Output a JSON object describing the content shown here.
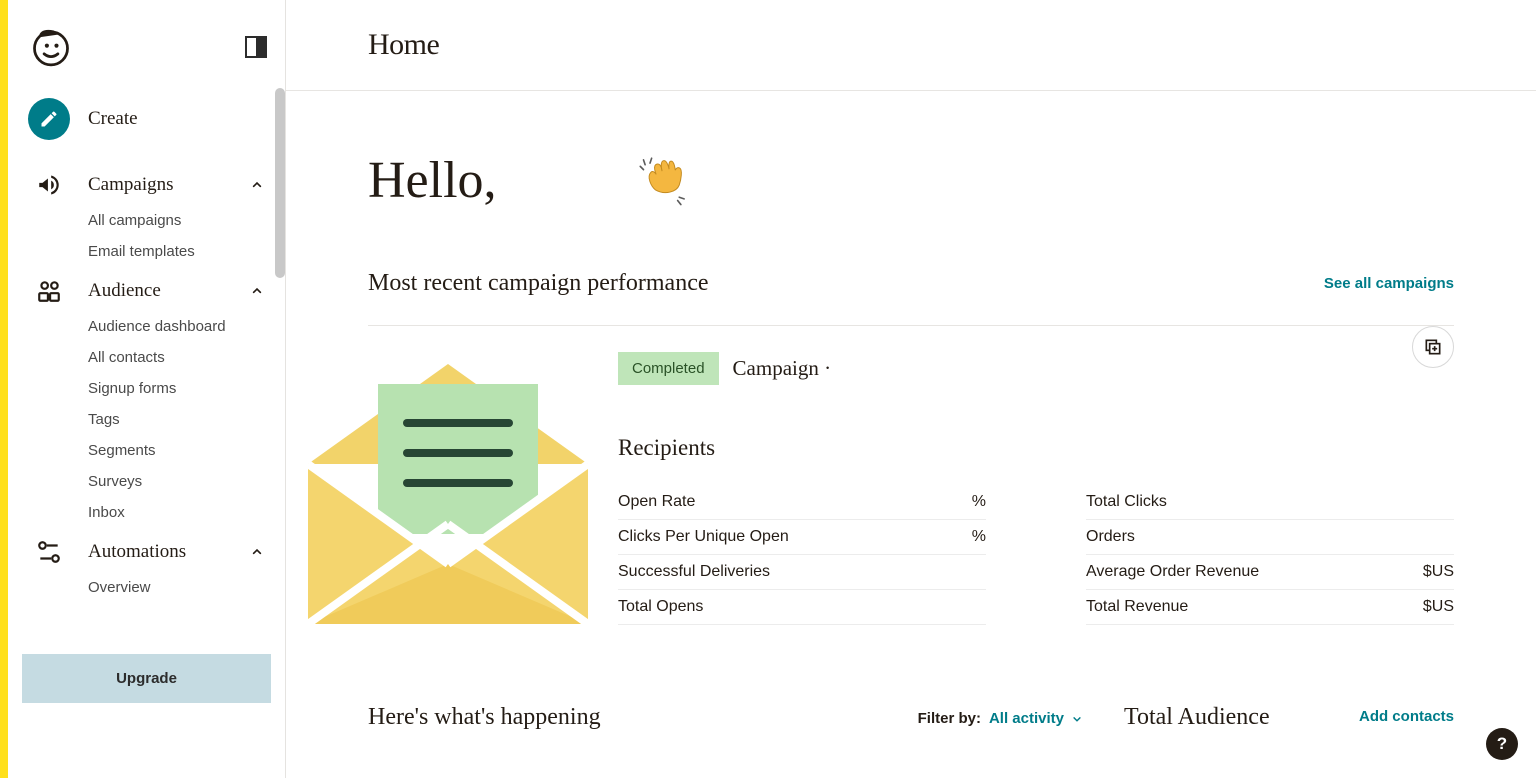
{
  "sidebar": {
    "create_label": "Create",
    "campaigns_label": "Campaigns",
    "campaigns_items": [
      "All campaigns",
      "Email templates"
    ],
    "audience_label": "Audience",
    "audience_items": [
      "Audience dashboard",
      "All contacts",
      "Signup forms",
      "Tags",
      "Segments",
      "Surveys",
      "Inbox"
    ],
    "automations_label": "Automations",
    "automations_items": [
      "Overview"
    ],
    "upgrade_label": "Upgrade"
  },
  "header": {
    "title": "Home"
  },
  "greeting": {
    "text": "Hello,"
  },
  "campaign_perf": {
    "title": "Most recent campaign performance",
    "see_all_label": "See all campaigns",
    "status_label": "Completed",
    "campaign_name": "Campaign ·",
    "recipients_label": "Recipients",
    "left_metrics": [
      {
        "label": "Open Rate",
        "value": "%"
      },
      {
        "label": "Clicks Per Unique Open",
        "value": "%"
      },
      {
        "label": "Successful Deliveries",
        "value": ""
      },
      {
        "label": "Total Opens",
        "value": ""
      }
    ],
    "right_metrics": [
      {
        "label": "Total Clicks",
        "value": ""
      },
      {
        "label": "Orders",
        "value": ""
      },
      {
        "label": "Average Order Revenue",
        "value": "$US"
      },
      {
        "label": "Total Revenue",
        "value": "$US"
      }
    ]
  },
  "happening": {
    "title": "Here's what's happening",
    "filter_label": "Filter by:",
    "filter_value": "All activity"
  },
  "audience_summary": {
    "title": "Total Audience",
    "add_contacts_label": "Add contacts"
  },
  "help_label": "?"
}
